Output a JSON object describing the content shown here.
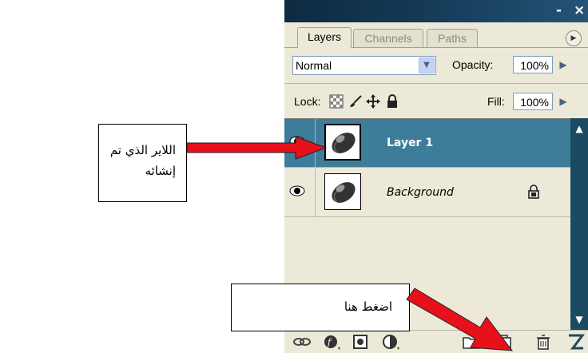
{
  "panel": {
    "titlebar": {
      "minimize_label": "-",
      "close_label": "×"
    },
    "tabs": [
      {
        "label": "Layers",
        "active": true
      },
      {
        "label": "Channels",
        "active": false
      },
      {
        "label": "Paths",
        "active": false
      }
    ],
    "blend_mode": "Normal",
    "opacity_label": "Opacity:",
    "opacity_value": "100%",
    "lock_label": "Lock:",
    "fill_label": "Fill:",
    "fill_value": "100%",
    "layers": [
      {
        "name": "Layer 1",
        "selected": true,
        "locked": false
      },
      {
        "name": "Background",
        "selected": false,
        "locked": true
      }
    ],
    "selection_color": "#3e7d9a"
  },
  "annotations": {
    "layer_callout_line1": "اللاير الذي تم",
    "layer_callout_line2": "إنشائه",
    "button_callout": "اضغط هنا",
    "arrow_color": "#e8101a"
  }
}
